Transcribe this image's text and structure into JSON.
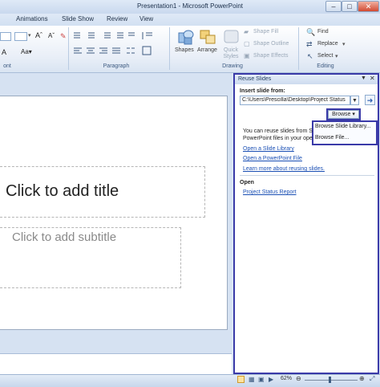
{
  "window": {
    "title": "Presentation1 - Microsoft PowerPoint"
  },
  "tabs": [
    "Animations",
    "Slide Show",
    "Review",
    "View"
  ],
  "ribbon": {
    "font_size": "",
    "groups": {
      "paragraph": "Paragraph",
      "drawing": "Drawing",
      "editing": "Editing"
    },
    "drawing": {
      "shapes": "Shapes",
      "arrange": "Arrange",
      "quick_styles": "Quick\nStyles",
      "shape_fill": "Shape Fill",
      "shape_outline": "Shape Outline",
      "shape_effects": "Shape Effects"
    },
    "editing": {
      "find": "Find",
      "replace": "Replace",
      "select": "Select"
    },
    "left_label": "ont"
  },
  "slide": {
    "title_placeholder": "Click to add title",
    "subtitle_placeholder": "Click to add subtitle"
  },
  "pane": {
    "title": "Reuse Slides",
    "insert_from_label": "Insert slide from:",
    "path_value": "C:\\Users\\Prescilla\\Desktop\\Project Status",
    "browse_label": "Browse",
    "browse_menu": [
      "Browse Slide Library...",
      "Browse File..."
    ],
    "info_line1": "You can reuse slides from S",
    "info_line2": "PowerPoint files in your ope",
    "links": [
      "Open a Slide Library",
      "Open a PowerPoint File",
      "Learn more about reusing slides."
    ],
    "open_heading": "Open",
    "recent_file": "Project Status Report"
  },
  "status": {
    "zoom": "62%"
  }
}
